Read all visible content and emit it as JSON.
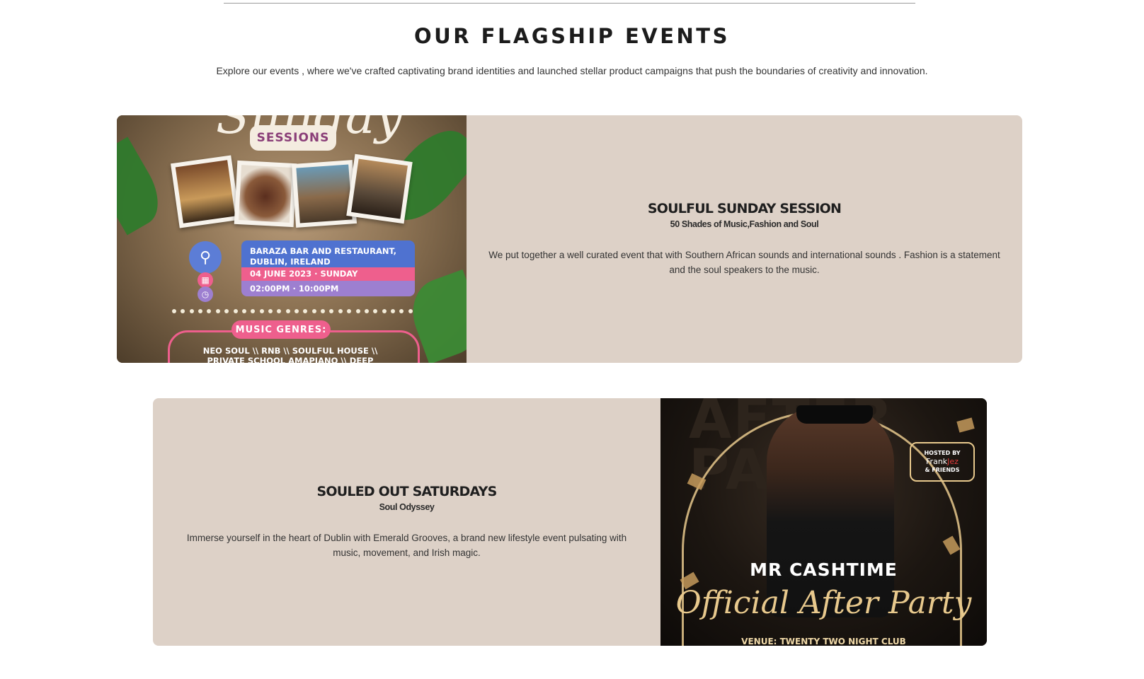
{
  "section": {
    "title": "OUR FLAGSHIP EVENTS",
    "subtitle": "Explore our events , where we've crafted captivating brand identities and launched stellar product campaigns that push the boundaries of creativity and innovation."
  },
  "events": [
    {
      "title": "SOULFUL SUNDAY SESSION",
      "tagline": "50 Shades of Music,Fashion and Soul",
      "description": "We put together a well curated event that with Southern African sounds and international sounds . Fashion is a statement and the soul speakers to the music.",
      "poster": {
        "script_title": "Sunday",
        "sessions_label": "SESSIONS",
        "venue_line1": "BARAZA BAR AND RESTAURANT,",
        "venue_line2": "DUBLIN, IRELAND",
        "date": "04 JUNE 2023 · SUNDAY",
        "time": "02:00PM · 10:00PM",
        "genres_label": "MUSIC GENRES:",
        "genres_line1": "NEO SOUL \\\\ RNB \\\\ SOULFUL HOUSE \\\\",
        "genres_line2": "PRIVATE SCHOOL AMAPIANO \\\\ DEEP",
        "icons": [
          "location-pin-icon",
          "calendar-icon",
          "clock-icon"
        ]
      }
    },
    {
      "title": "SOULED OUT SATURDAYS",
      "tagline": "Soul Odyssey",
      "description": "Immerse yourself in the heart of Dublin with Emerald Grooves, a brand new lifestyle event pulsating with music, movement, and Irish magic.",
      "poster": {
        "backdrop_text_1": "AFTER",
        "backdrop_text_2": "PARTY",
        "hosted_by": "HOSTED BY",
        "host_name_1": "Frank",
        "host_name_2": "Jez",
        "host_friends": "& FRIENDS",
        "artist": "MR CASHTIME",
        "script_title": "Official After Party",
        "venue": "VENUE: TWENTY TWO NIGHT CLUB"
      }
    }
  ],
  "colors": {
    "card_bg": "#ddd1c7",
    "rule": "#9b9b9b",
    "pink": "#ee5f8d",
    "blue": "#4f72d0",
    "gold": "#e8c98d"
  }
}
